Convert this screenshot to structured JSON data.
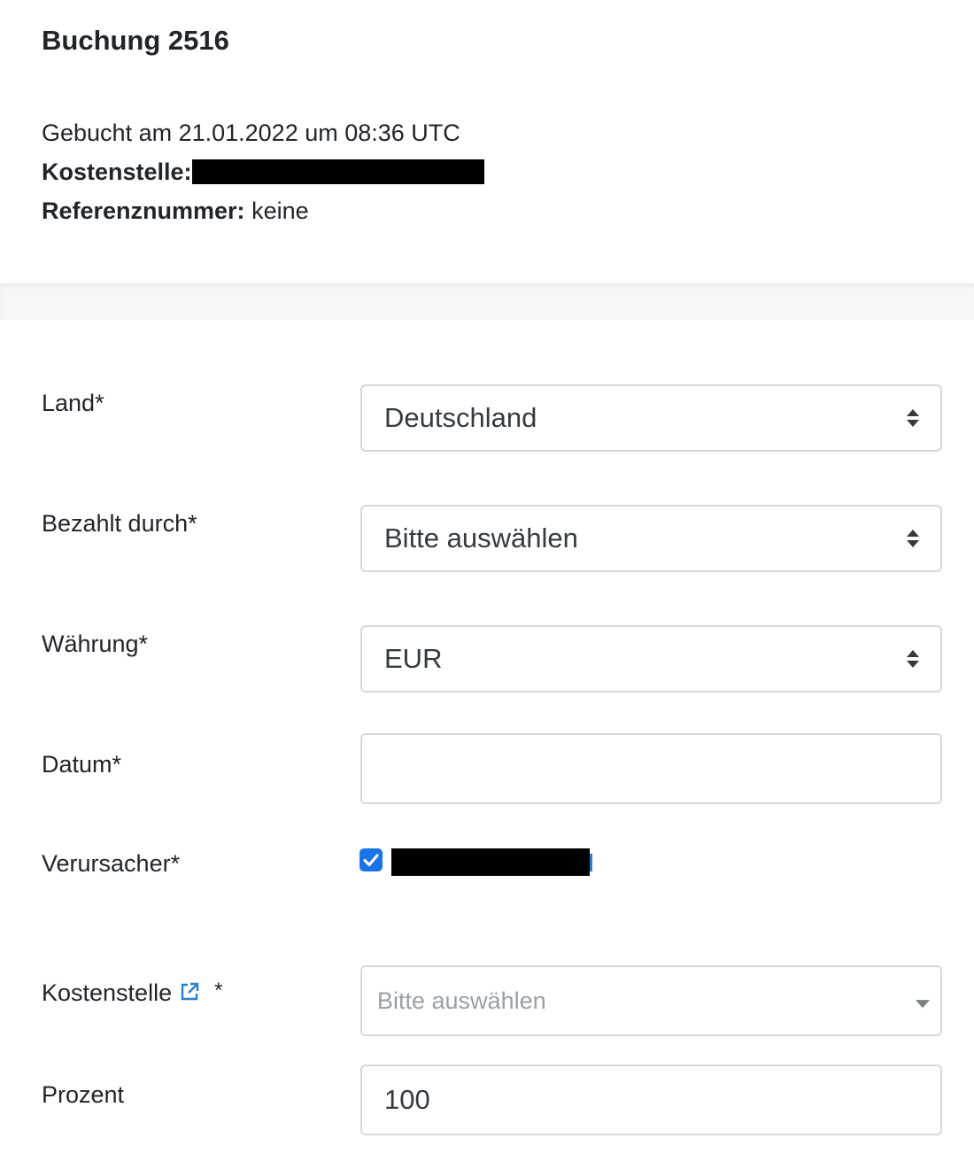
{
  "booking": {
    "title": "Buchung 2516",
    "booked_at": "Gebucht am 21.01.2022 um 08:36 UTC",
    "cost_center_label": "Kostenstelle:",
    "reference_label": "Referenznummer:",
    "reference_value": "keine"
  },
  "form": {
    "country": {
      "label": "Land*",
      "value": "Deutschland"
    },
    "paid_by": {
      "label": "Bezahlt durch*",
      "value": "Bitte auswählen"
    },
    "currency": {
      "label": "Währung*",
      "value": "EUR"
    },
    "date": {
      "label": "Datum*",
      "value": ""
    },
    "originator": {
      "label": "Verursacher*",
      "checked": true
    },
    "cost_center": {
      "label": "Kostenstelle",
      "required_mark": "*",
      "placeholder": "Bitte auswählen"
    },
    "percent": {
      "label": "Prozent",
      "value": "100"
    }
  },
  "icons": {
    "external_link": "external-link-icon",
    "updown": "updown-arrows-icon",
    "caret": "chevron-down-icon",
    "check": "check-icon"
  },
  "colors": {
    "accent": "#1a73e8",
    "link_icon": "#2a7fd4",
    "border": "#d6d9dc",
    "placeholder": "#9a9fa5"
  }
}
